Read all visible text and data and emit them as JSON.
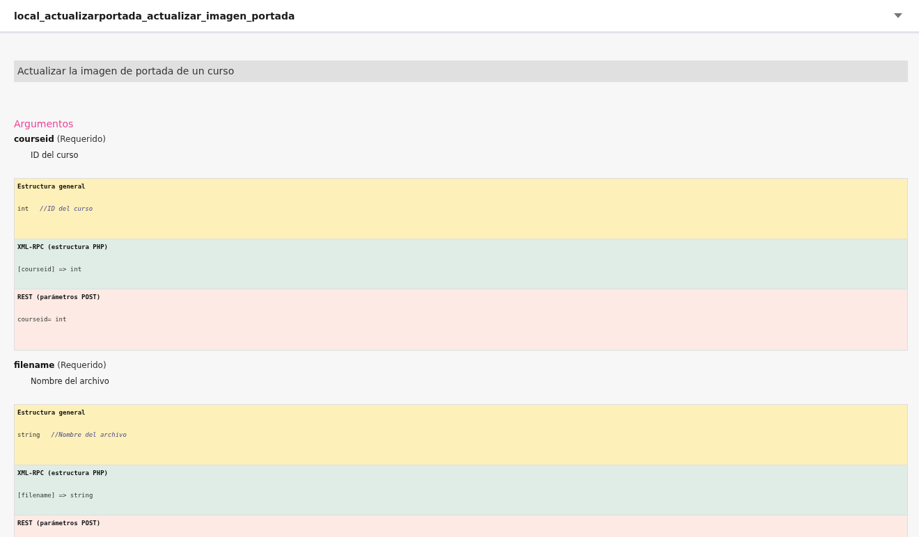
{
  "header": {
    "title": "local_actualizarportada_actualizar_imagen_portada",
    "expanded": true
  },
  "description": "Actualizar la imagen de portada de un curso",
  "arguments_heading": "Argumentos",
  "arguments": [
    {
      "name": "courseid",
      "requirement": "(Requerido)",
      "description": "ID del curso",
      "blocks": [
        {
          "kind": "general",
          "title": "Estructura general",
          "code": "int",
          "comment": "//ID del curso"
        },
        {
          "kind": "xmlrpc",
          "title": "XML-RPC (estructura PHP)",
          "code": "[courseid] => int"
        },
        {
          "kind": "rest",
          "title": "REST (parámetros POST)",
          "code": "courseid= int"
        }
      ]
    },
    {
      "name": "filename",
      "requirement": "(Requerido)",
      "description": "Nombre del archivo",
      "blocks": [
        {
          "kind": "general",
          "title": "Estructura general",
          "code": "string",
          "comment": "//Nombre del archivo"
        },
        {
          "kind": "xmlrpc",
          "title": "XML-RPC (estructura PHP)",
          "code": "[filename] => string"
        },
        {
          "kind": "rest",
          "title": "REST (parámetros POST)"
        }
      ]
    }
  ]
}
